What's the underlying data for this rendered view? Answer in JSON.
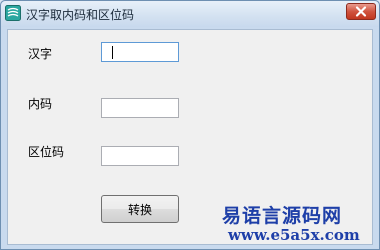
{
  "window": {
    "title": "汉字取内码和区位码",
    "app_icon": "app-icon",
    "close_icon": "close-icon",
    "close_color": "#c9402b"
  },
  "form": {
    "hanzi_label": "汉字",
    "neima_label": "内码",
    "quweima_label": "区位码",
    "hanzi_value": "",
    "neima_value": "",
    "quweima_value": "",
    "convert_label": "转换"
  },
  "watermark": {
    "name": "易语言源码网",
    "url": "www.e5a5x.com",
    "color": "#1e3fa8"
  }
}
